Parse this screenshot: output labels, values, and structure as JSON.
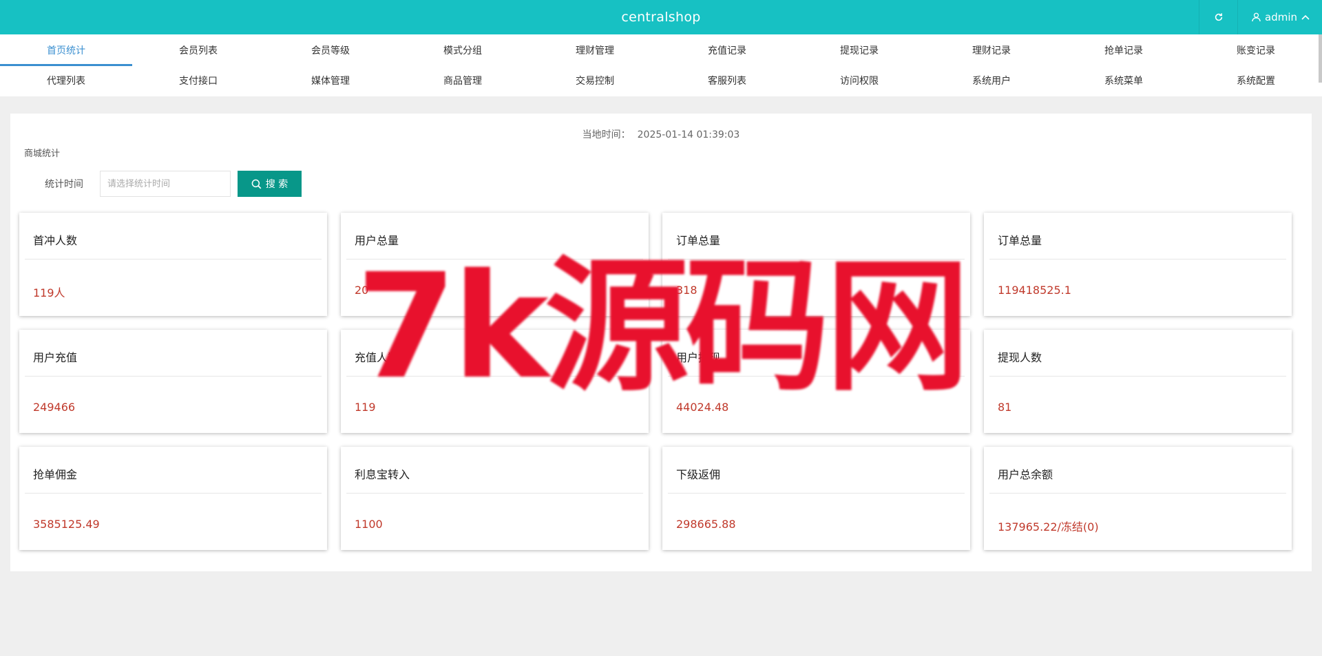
{
  "header": {
    "brand": "centralshop",
    "user": "admin",
    "colors": {
      "bar": "#17c1c3",
      "active_tab": "#3a8fd0",
      "search_button": "#089789",
      "value": "#c0392b"
    }
  },
  "menu": {
    "row1": [
      "首页统计",
      "会员列表",
      "会员等级",
      "模式分组",
      "理财管理",
      "充值记录",
      "提现记录",
      "理财记录",
      "抢单记录",
      "账变记录"
    ],
    "row2": [
      "代理列表",
      "支付接口",
      "媒体管理",
      "商品管理",
      "交易控制",
      "客服列表",
      "访问权限",
      "系统用户",
      "系统菜单",
      "系统配置"
    ],
    "active": "首页统计"
  },
  "main": {
    "local_time_label": "当地时间：",
    "local_time": "2025-01-14 01:39:03",
    "section_title": "商城统计",
    "filter_label": "统计时间",
    "filter_placeholder": "请选择统计时间",
    "filter_value": "",
    "search_label": "搜 索"
  },
  "cards": [
    {
      "title": "首冲人数",
      "value": "119人"
    },
    {
      "title": "用户总量",
      "value": "20"
    },
    {
      "title": "订单总量",
      "value": "318"
    },
    {
      "title": "订单总量",
      "value": "119418525.1"
    },
    {
      "title": "用户充值",
      "value": "249466"
    },
    {
      "title": "充值人数",
      "value": "119"
    },
    {
      "title": "用户提现",
      "value": "44024.48"
    },
    {
      "title": "提现人数",
      "value": "81"
    },
    {
      "title": "抢单佣金",
      "value": "3585125.49"
    },
    {
      "title": "利息宝转入",
      "value": "1100"
    },
    {
      "title": "下级返佣",
      "value": "298665.88"
    },
    {
      "title": "用户总余额",
      "value": "137965.22/冻结(0)"
    }
  ],
  "watermark": "7k源码网"
}
